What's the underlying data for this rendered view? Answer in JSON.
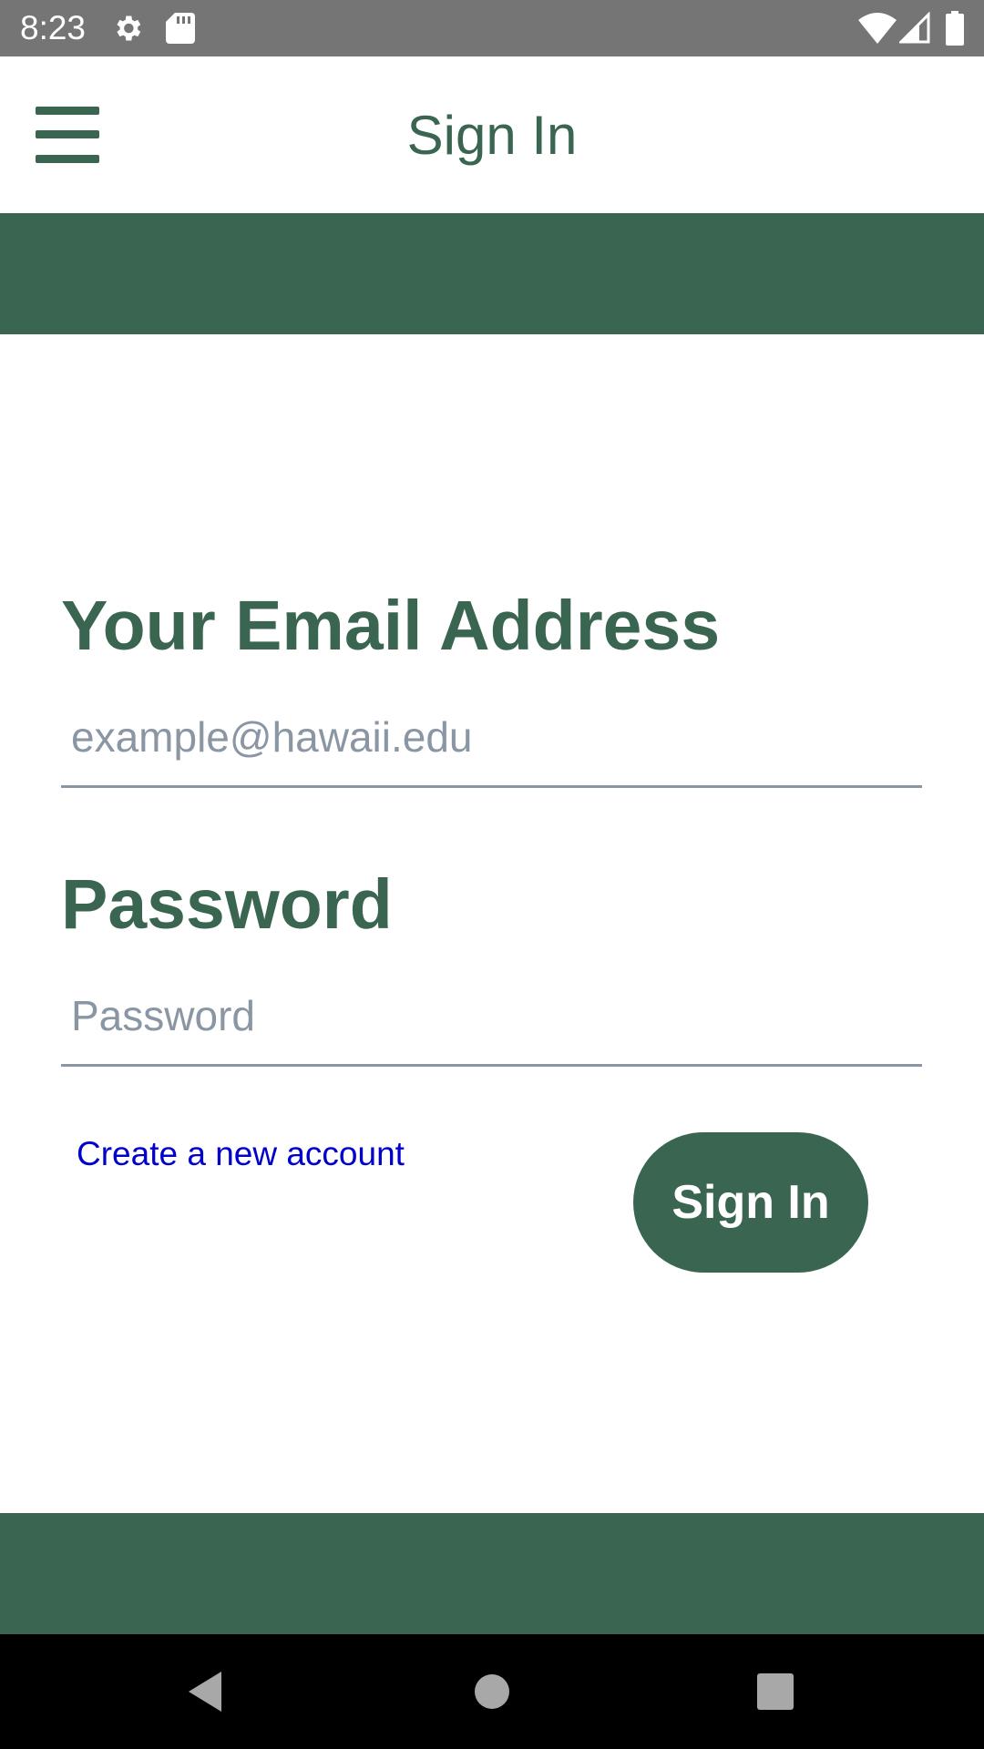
{
  "status_bar": {
    "time": "8:23",
    "icons": [
      "gear-icon",
      "sd-card-icon",
      "wifi-icon",
      "signal-icon",
      "battery-icon"
    ]
  },
  "app_bar": {
    "title": "Sign In",
    "menu_icon": "hamburger-menu-icon"
  },
  "form": {
    "email_label": "Your Email Address",
    "email_placeholder": "example@hawaii.edu",
    "email_value": "",
    "password_label": "Password",
    "password_placeholder": "Password",
    "password_value": "",
    "create_account_link": "Create a new account",
    "sign_in_button": "Sign In"
  },
  "nav_bar": {
    "icons": [
      "back-icon",
      "home-icon",
      "recents-icon"
    ]
  },
  "colors": {
    "primary": "#3a6651",
    "link": "#0000cc",
    "status_bar": "#757575",
    "input_underline": "#8a96a3"
  }
}
